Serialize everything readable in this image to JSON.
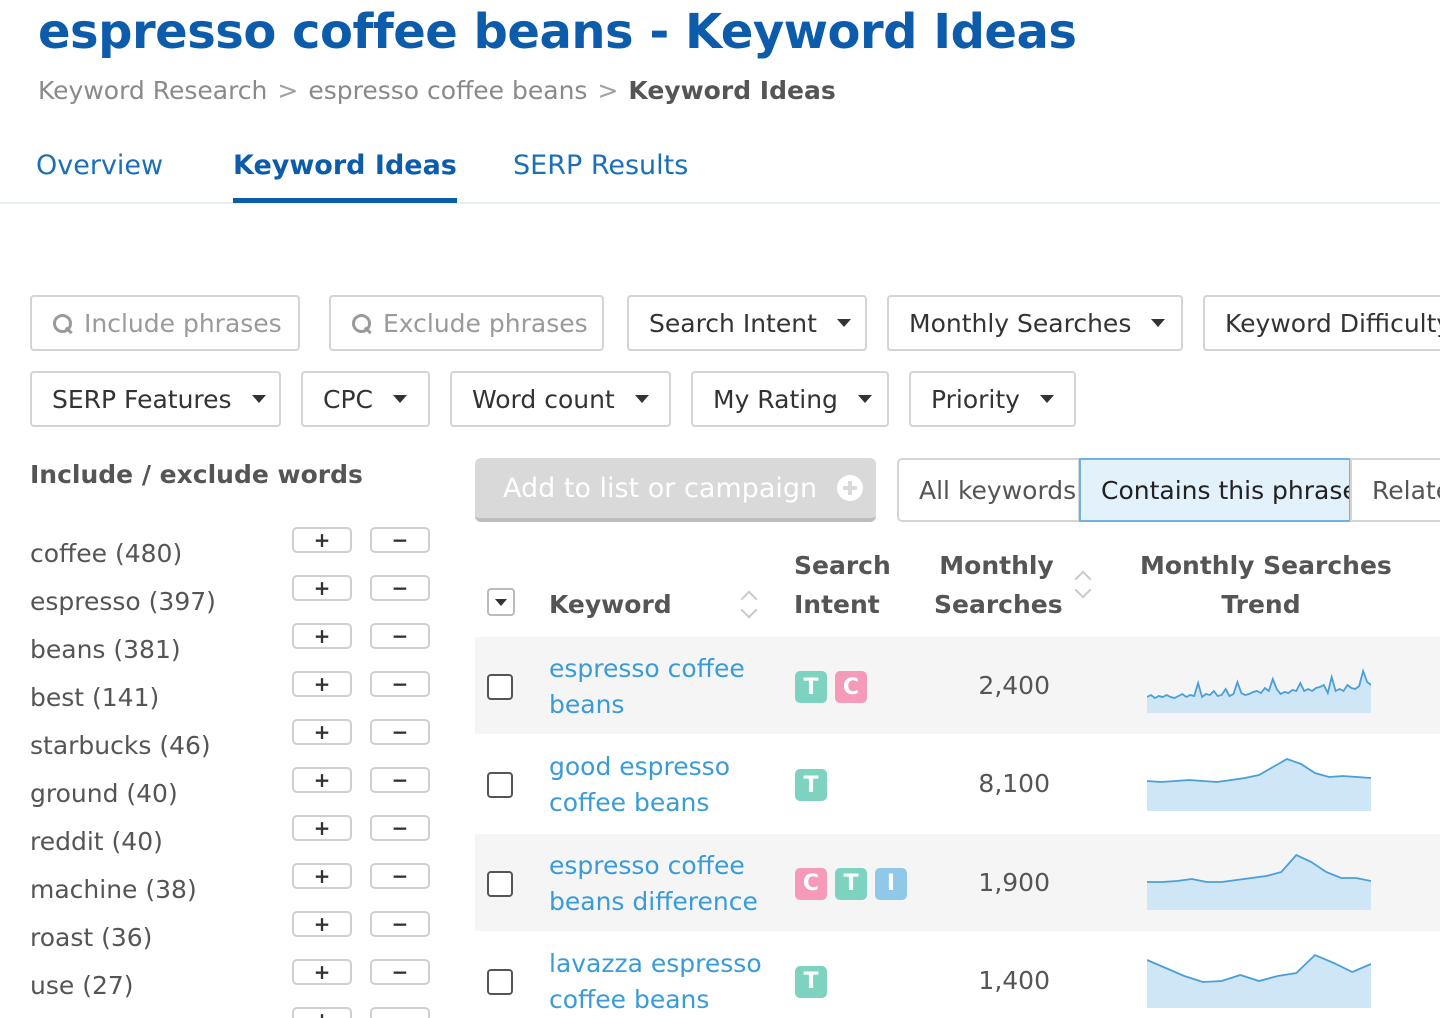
{
  "header": {
    "title": "espresso coffee beans - Keyword Ideas",
    "breadcrumb": [
      "Keyword Research",
      "espresso coffee beans",
      "Keyword Ideas"
    ],
    "breadcrumb_separator": ">"
  },
  "tabs": [
    {
      "label": "Overview",
      "active": false
    },
    {
      "label": "Keyword Ideas",
      "active": true
    },
    {
      "label": "SERP Results",
      "active": false
    }
  ],
  "filters": {
    "include_placeholder": "Include phrases",
    "exclude_placeholder": "Exclude phrases",
    "dropdowns": [
      "Search Intent",
      "Monthly Searches",
      "Keyword Difficulty",
      "SERP Features",
      "CPC",
      "Word count",
      "My Rating",
      "Priority"
    ]
  },
  "sidebar": {
    "heading": "Include / exclude words",
    "plus_symbol": "+",
    "minus_symbol": "−",
    "words": [
      {
        "label": "coffee (480)"
      },
      {
        "label": "espresso (397)"
      },
      {
        "label": "beans (381)"
      },
      {
        "label": "best (141)"
      },
      {
        "label": "starbucks (46)"
      },
      {
        "label": "ground (40)"
      },
      {
        "label": "reddit (40)"
      },
      {
        "label": "machine (38)"
      },
      {
        "label": "roast (36)"
      },
      {
        "label": "use (27)"
      },
      {
        "label": ""
      }
    ]
  },
  "actions": {
    "add_button": "Add to list or campaign"
  },
  "segments": [
    {
      "label": "All keywords",
      "active": false
    },
    {
      "label": "Contains this phrase",
      "active": true
    },
    {
      "label": "Related",
      "active": false
    }
  ],
  "table": {
    "headers": {
      "keyword": "Keyword",
      "intent_line1": "Search",
      "intent_line2": "Intent",
      "searches_line1": "Monthly",
      "searches_line2": "Searches",
      "trend_line1": "Monthly Searches",
      "trend_line2": "Trend"
    },
    "intent_colors": {
      "T": "#7dd3c0",
      "C": "#f59ab8",
      "I": "#8fc8e8"
    },
    "trend_colors": {
      "line": "#4a9fd8",
      "fill": "#cfe6f7"
    },
    "rows": [
      {
        "keyword": "espresso coffee beans",
        "intents": [
          "T",
          "C"
        ],
        "searches": "2,400",
        "trend": [
          16,
          18,
          15,
          17,
          16,
          18,
          16,
          15,
          17,
          19,
          16,
          18,
          17,
          30,
          16,
          19,
          18,
          22,
          17,
          18,
          24,
          17,
          19,
          31,
          20,
          18,
          19,
          21,
          22,
          20,
          25,
          22,
          34,
          24,
          19,
          21,
          20,
          23,
          22,
          30,
          22,
          24,
          22,
          25,
          26,
          28,
          20,
          36,
          22,
          24,
          22,
          28,
          25,
          24,
          27,
          42,
          31,
          28
        ]
      },
      {
        "keyword": "good espresso coffee beans",
        "intents": [
          "T"
        ],
        "searches": "8,100",
        "trend": [
          30,
          29,
          30,
          31,
          30,
          29,
          31,
          33,
          36,
          44,
          52,
          47,
          38,
          34,
          35,
          34,
          33
        ]
      },
      {
        "keyword": "espresso coffee beans difference",
        "intents": [
          "C",
          "T",
          "I"
        ],
        "searches": "1,900",
        "trend": [
          28,
          28,
          29,
          31,
          28,
          28,
          30,
          32,
          34,
          38,
          55,
          48,
          38,
          32,
          32,
          29
        ]
      },
      {
        "keyword": "lavazza espresso coffee beans",
        "intents": [
          "T"
        ],
        "searches": "1,400",
        "trend": [
          48,
          40,
          32,
          26,
          27,
          33,
          27,
          32,
          35,
          53,
          45,
          36,
          44
        ]
      }
    ]
  }
}
